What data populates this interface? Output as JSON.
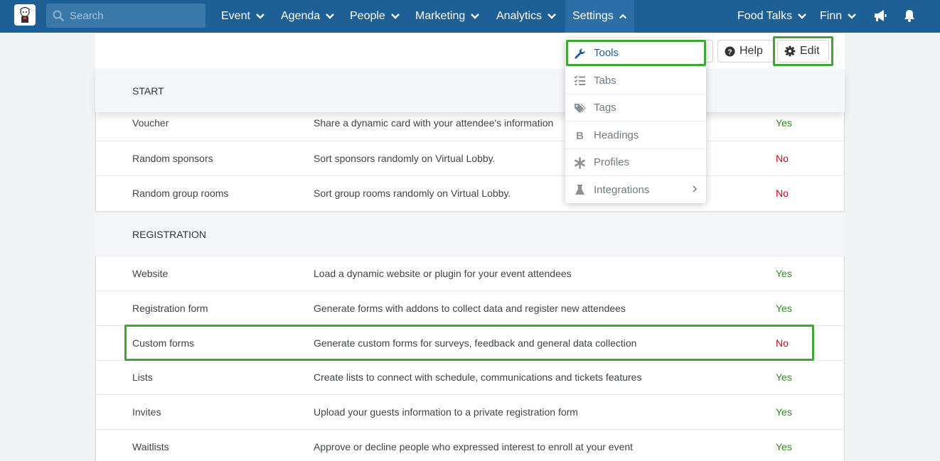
{
  "colors": {
    "nav_bg": "#1e5f95",
    "accent": "#1e5f95",
    "yes": "#2f8a1f",
    "no": "#d0021b",
    "highlight": "#3fa535"
  },
  "search": {
    "placeholder": "Search"
  },
  "nav": {
    "event": "Event",
    "agenda": "Agenda",
    "people": "People",
    "marketing": "Marketing",
    "analytics": "Analytics",
    "settings": "Settings",
    "event_name": "Food Talks",
    "user": "Finn"
  },
  "toolbar": {
    "help_label": "Help",
    "edit_label": "Edit"
  },
  "dropdown": {
    "items": [
      {
        "label": "Tools",
        "icon": "wrench-icon"
      },
      {
        "label": "Tabs",
        "icon": "list-check-icon"
      },
      {
        "label": "Tags",
        "icon": "tags-icon"
      },
      {
        "label": "Headings",
        "icon": "bold-icon"
      },
      {
        "label": "Profiles",
        "icon": "asterisk-icon"
      },
      {
        "label": "Integrations",
        "icon": "flask-icon"
      }
    ]
  },
  "sections": {
    "start": {
      "title": "START",
      "rows": [
        {
          "name": "Voucher",
          "description": "Share a dynamic card with your attendee's information",
          "status": "Yes"
        },
        {
          "name": "Random sponsors",
          "description": "Sort sponsors randomly on Virtual Lobby.",
          "status": "No"
        },
        {
          "name": "Random group rooms",
          "description": "Sort group rooms randomly on Virtual Lobby.",
          "status": "No"
        }
      ]
    },
    "registration": {
      "title": "REGISTRATION",
      "rows": [
        {
          "name": "Website",
          "description": "Load a dynamic website or plugin for your event attendees",
          "status": "Yes"
        },
        {
          "name": "Registration form",
          "description": "Generate forms with addons to collect data and register new attendees",
          "status": "Yes"
        },
        {
          "name": "Custom forms",
          "description": "Generate custom forms for surveys, feedback and general data collection",
          "status": "No"
        },
        {
          "name": "Lists",
          "description": "Create lists to connect with schedule, communications and tickets features",
          "status": "Yes"
        },
        {
          "name": "Invites",
          "description": "Upload your guests information to a private registration form",
          "status": "Yes"
        },
        {
          "name": "Waitlists",
          "description": "Approve or decline people who expressed interest to enroll at your event",
          "status": "Yes"
        }
      ]
    }
  }
}
